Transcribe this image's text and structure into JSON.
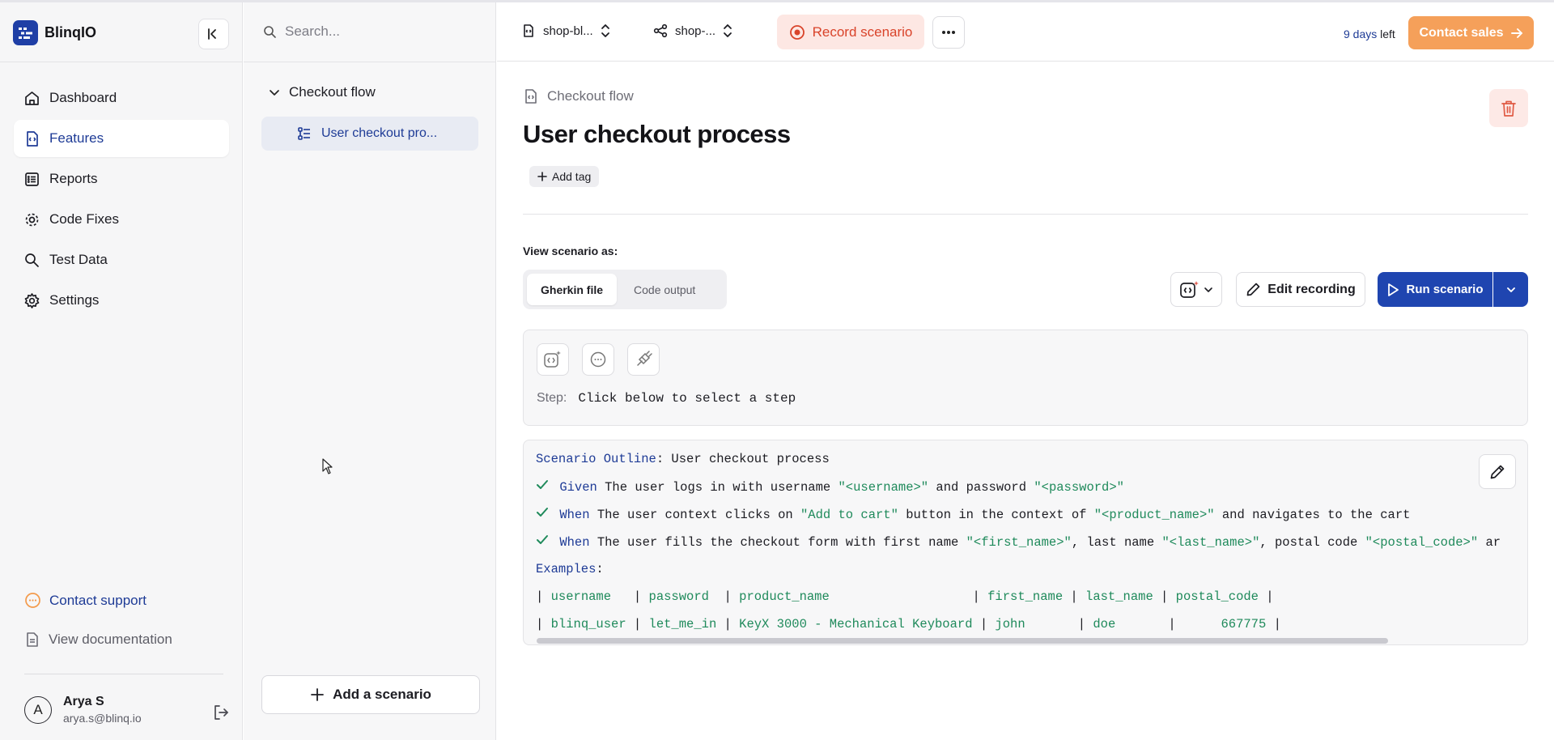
{
  "brand": {
    "name": "BlinqIO"
  },
  "sidebar": {
    "items": [
      {
        "label": "Dashboard"
      },
      {
        "label": "Features"
      },
      {
        "label": "Reports"
      },
      {
        "label": "Code Fixes"
      },
      {
        "label": "Test Data"
      },
      {
        "label": "Settings"
      }
    ],
    "contact_support": "Contact support",
    "view_docs": "View documentation",
    "user": {
      "name": "Arya S",
      "email": "arya.s@blinq.io",
      "initial": "A"
    }
  },
  "tree": {
    "search_placeholder": "Search...",
    "folder": "Checkout flow",
    "scenario": "User checkout pro...",
    "add_scenario": "Add a scenario"
  },
  "topbar": {
    "project": "shop-bl...",
    "branch": "shop-...",
    "record": "Record scenario",
    "trial_days": "9 days",
    "trial_suffix": "left",
    "contact_sales": "Contact sales"
  },
  "main": {
    "breadcrumb": "Checkout flow",
    "title": "User checkout process",
    "add_tag": "Add tag",
    "view_label": "View scenario as:",
    "tabs": [
      {
        "label": "Gherkin file"
      },
      {
        "label": "Code output"
      }
    ],
    "edit_recording": "Edit recording",
    "run_scenario": "Run scenario",
    "step_label": "Step:",
    "step_value": "Click below to select a step"
  },
  "gherkin": {
    "outline_kw": "Scenario Outline",
    "outline_title": ": User checkout process",
    "steps": [
      {
        "kw": "Given",
        "parts": [
          " The user logs in with username ",
          "\"<username>\"",
          " and password ",
          "\"<password>\""
        ]
      },
      {
        "kw": "When",
        "parts": [
          " The user context clicks on ",
          "\"Add to cart\"",
          " button in the context of ",
          "\"<product_name>\"",
          " and navigates to the cart"
        ]
      },
      {
        "kw": "When",
        "parts": [
          " The user fills the checkout form with first name ",
          "\"<first_name>\"",
          ", last name ",
          "\"<last_name>\"",
          ", postal code ",
          "\"<postal_code>\"",
          " ar"
        ]
      }
    ],
    "examples_kw": "Examples",
    "table_header": [
      "username  ",
      "password ",
      "product_name                  ",
      "first_name",
      "last_name",
      "postal_code"
    ],
    "table_row": [
      "blinq_user",
      "let_me_in",
      "KeyX 3000 - Mechanical Keyboard",
      "john      ",
      "doe      ",
      "     667775"
    ]
  },
  "colors": {
    "accent": "#1f45b0",
    "record": "#d9432a",
    "sales": "#f5a05a",
    "string": "#1f8a5b"
  }
}
